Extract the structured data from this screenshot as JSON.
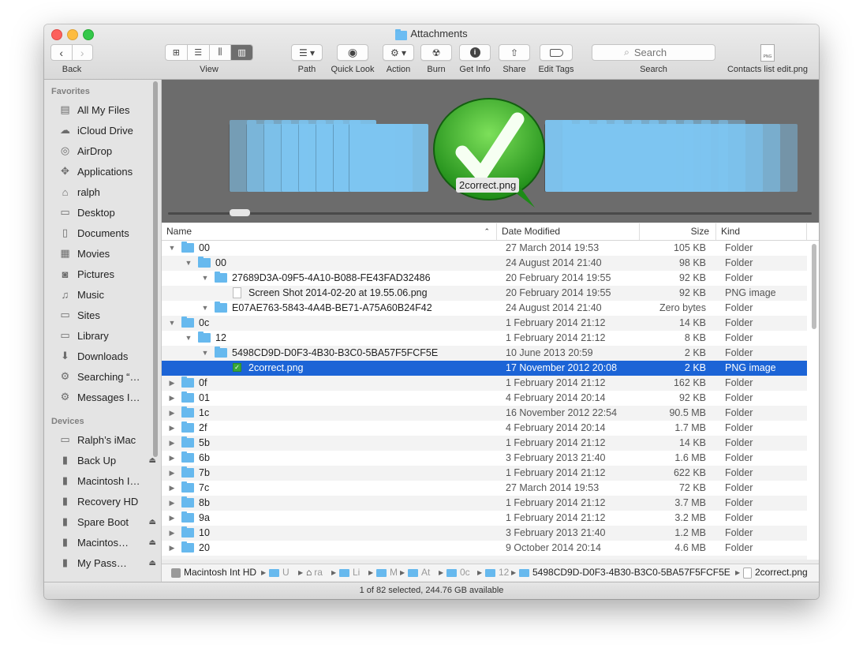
{
  "window": {
    "title": "Attachments"
  },
  "toolbar": {
    "back_label": "Back",
    "view_label": "View",
    "path_label": "Path",
    "quicklook_label": "Quick Look",
    "action_label": "Action",
    "burn_label": "Burn",
    "getinfo_label": "Get Info",
    "share_label": "Share",
    "edittags_label": "Edit Tags",
    "search_placeholder": "Search",
    "search_label": "Search",
    "preview_file_label": "Contacts list edit.png",
    "preview_file_badge": "PNG"
  },
  "sidebar": {
    "favorites_header": "Favorites",
    "favorites": [
      {
        "label": "All My Files",
        "icon": "all-files-icon"
      },
      {
        "label": "iCloud Drive",
        "icon": "cloud-icon"
      },
      {
        "label": "AirDrop",
        "icon": "airdrop-icon"
      },
      {
        "label": "Applications",
        "icon": "applications-icon"
      },
      {
        "label": "ralph",
        "icon": "home-icon"
      },
      {
        "label": "Desktop",
        "icon": "desktop-icon"
      },
      {
        "label": "Documents",
        "icon": "documents-icon"
      },
      {
        "label": "Movies",
        "icon": "movies-icon"
      },
      {
        "label": "Pictures",
        "icon": "pictures-icon"
      },
      {
        "label": "Music",
        "icon": "music-icon"
      },
      {
        "label": "Sites",
        "icon": "folder-icon"
      },
      {
        "label": "Library",
        "icon": "folder-icon"
      },
      {
        "label": "Downloads",
        "icon": "downloads-icon"
      },
      {
        "label": "Searching “…",
        "icon": "smart-folder-icon"
      },
      {
        "label": "Messages I…",
        "icon": "smart-folder-icon"
      }
    ],
    "devices_header": "Devices",
    "devices": [
      {
        "label": "Ralph’s iMac",
        "icon": "imac-icon",
        "eject": ""
      },
      {
        "label": "Back Up",
        "icon": "disk-icon",
        "eject": "⏏"
      },
      {
        "label": "Macintosh I…",
        "icon": "disk-icon",
        "eject": ""
      },
      {
        "label": "Recovery HD",
        "icon": "disk-icon",
        "eject": ""
      },
      {
        "label": "Spare Boot",
        "icon": "disk-icon",
        "eject": "⏏"
      },
      {
        "label": "Macintos…",
        "icon": "disk-icon",
        "eject": "⏏"
      },
      {
        "label": "My Pass…",
        "icon": "disk-icon",
        "eject": "⏏"
      }
    ]
  },
  "coverflow": {
    "selected_label": "2correct.png"
  },
  "list": {
    "columns": {
      "name": "Name",
      "date": "Date Modified",
      "size": "Size",
      "kind": "Kind"
    },
    "rows": [
      {
        "level": 0,
        "disc": "▼",
        "icon": "folder",
        "name": "00",
        "date": "27 March 2014 19:53",
        "size": "105 KB",
        "kind": "Folder"
      },
      {
        "level": 1,
        "disc": "▼",
        "icon": "folder",
        "name": "00",
        "date": "24 August 2014 21:40",
        "size": "98 KB",
        "kind": "Folder"
      },
      {
        "level": 2,
        "disc": "▼",
        "icon": "folder",
        "name": "27689D3A-09F5-4A10-B088-FE43FAD32486",
        "date": "20 February 2014 19:55",
        "size": "92 KB",
        "kind": "Folder"
      },
      {
        "level": 3,
        "disc": "",
        "icon": "png",
        "name": "Screen Shot 2014-02-20 at 19.55.06.png",
        "date": "20 February 2014 19:55",
        "size": "92 KB",
        "kind": "PNG image"
      },
      {
        "level": 2,
        "disc": "▼",
        "icon": "folder",
        "name": "E07AE763-5843-4A4B-BE71-A75A60B24F42",
        "date": "24 August 2014 21:40",
        "size": "Zero bytes",
        "kind": "Folder"
      },
      {
        "level": 0,
        "disc": "▼",
        "icon": "folder",
        "name": "0c",
        "date": "1 February 2014 21:12",
        "size": "14 KB",
        "kind": "Folder"
      },
      {
        "level": 1,
        "disc": "▼",
        "icon": "folder",
        "name": "12",
        "date": "1 February 2014 21:12",
        "size": "8 KB",
        "kind": "Folder"
      },
      {
        "level": 2,
        "disc": "▼",
        "icon": "folder",
        "name": "5498CD9D-D0F3-4B30-B3C0-5BA57F5FCF5E",
        "date": "10 June 2013 20:59",
        "size": "2 KB",
        "kind": "Folder"
      },
      {
        "level": 3,
        "disc": "",
        "icon": "check",
        "name": "2correct.png",
        "date": "17 November 2012 20:08",
        "size": "2 KB",
        "kind": "PNG image",
        "selected": true
      },
      {
        "level": 0,
        "disc": "▶",
        "icon": "folder",
        "name": "0f",
        "date": "1 February 2014 21:12",
        "size": "162 KB",
        "kind": "Folder"
      },
      {
        "level": 0,
        "disc": "▶",
        "icon": "folder",
        "name": "01",
        "date": "4 February 2014 20:14",
        "size": "92 KB",
        "kind": "Folder"
      },
      {
        "level": 0,
        "disc": "▶",
        "icon": "folder",
        "name": "1c",
        "date": "16 November 2012 22:54",
        "size": "90.5 MB",
        "kind": "Folder"
      },
      {
        "level": 0,
        "disc": "▶",
        "icon": "folder",
        "name": "2f",
        "date": "4 February 2014 20:14",
        "size": "1.7 MB",
        "kind": "Folder"
      },
      {
        "level": 0,
        "disc": "▶",
        "icon": "folder",
        "name": "5b",
        "date": "1 February 2014 21:12",
        "size": "14 KB",
        "kind": "Folder"
      },
      {
        "level": 0,
        "disc": "▶",
        "icon": "folder",
        "name": "6b",
        "date": "3 February 2013 21:40",
        "size": "1.6 MB",
        "kind": "Folder"
      },
      {
        "level": 0,
        "disc": "▶",
        "icon": "folder",
        "name": "7b",
        "date": "1 February 2014 21:12",
        "size": "622 KB",
        "kind": "Folder"
      },
      {
        "level": 0,
        "disc": "▶",
        "icon": "folder",
        "name": "7c",
        "date": "27 March 2014 19:53",
        "size": "72 KB",
        "kind": "Folder"
      },
      {
        "level": 0,
        "disc": "▶",
        "icon": "folder",
        "name": "8b",
        "date": "1 February 2014 21:12",
        "size": "3.7 MB",
        "kind": "Folder"
      },
      {
        "level": 0,
        "disc": "▶",
        "icon": "folder",
        "name": "9a",
        "date": "1 February 2014 21:12",
        "size": "3.2 MB",
        "kind": "Folder"
      },
      {
        "level": 0,
        "disc": "▶",
        "icon": "folder",
        "name": "10",
        "date": "3 February 2013 21:40",
        "size": "1.2 MB",
        "kind": "Folder"
      },
      {
        "level": 0,
        "disc": "▶",
        "icon": "folder",
        "name": "20",
        "date": "9 October 2014 20:14",
        "size": "4.6 MB",
        "kind": "Folder"
      }
    ]
  },
  "pathbar": {
    "segments": [
      {
        "label": "Macintosh Int HD",
        "icon": "disk"
      },
      {
        "label": "U",
        "icon": "folder"
      },
      {
        "label": "ra",
        "icon": "home"
      },
      {
        "label": "Li",
        "icon": "folder"
      },
      {
        "label": "M",
        "icon": "folder"
      },
      {
        "label": "At",
        "icon": "folder"
      },
      {
        "label": "0c",
        "icon": "folder"
      },
      {
        "label": "12",
        "icon": "folder"
      },
      {
        "label": "5498CD9D-D0F3-4B30-B3C0-5BA57F5FCF5E",
        "icon": "folder"
      },
      {
        "label": "2correct.png",
        "icon": "file"
      }
    ]
  },
  "status": {
    "text": "1 of 82 selected, 244.76 GB available"
  },
  "colors": {
    "selection": "#1c64d6",
    "folder": "#67b9ee",
    "sidebar_bg": "#e4e4e4",
    "coverflow_bg": "#6c6c6c"
  }
}
